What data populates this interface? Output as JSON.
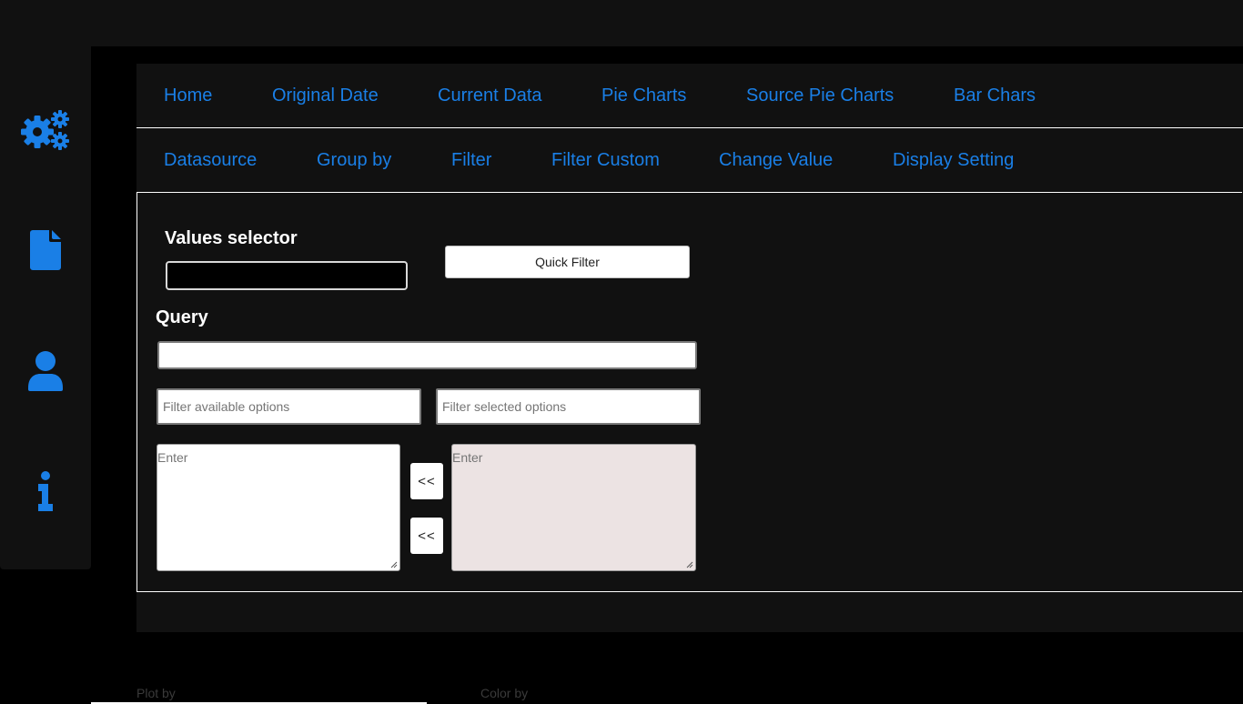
{
  "sidebar": {
    "icons": [
      {
        "name": "settings-gears-icon"
      },
      {
        "name": "document-icon"
      },
      {
        "name": "user-icon"
      },
      {
        "name": "info-icon"
      }
    ]
  },
  "nav_primary": {
    "items": [
      "Home",
      "Original Date",
      "Current Data",
      "Pie Charts",
      "Source Pie Charts",
      "Bar Chars"
    ]
  },
  "nav_secondary": {
    "items": [
      "Datasource",
      "Group by",
      "Filter",
      "Filter Custom",
      "Change Value",
      "Display Setting"
    ]
  },
  "filter_panel": {
    "values_selector_label": "Values selector",
    "values_selector_value": "",
    "quick_filter_label": "Quick Filter",
    "query_label": "Query",
    "query_value": "",
    "filter_available_placeholder": "Filter available options",
    "filter_selected_placeholder": "Filter selected options",
    "available_placeholder": "Enter",
    "selected_placeholder": "Enter",
    "move_buttons": [
      "<<",
      "<<"
    ]
  },
  "footer": {
    "plot_by_label": "Plot by",
    "color_by_label": "Color by"
  },
  "colors": {
    "accent": "#1a7fe6",
    "panel_bg": "#111111",
    "page_bg": "#000000",
    "selected_list_bg": "#ece3e3"
  }
}
